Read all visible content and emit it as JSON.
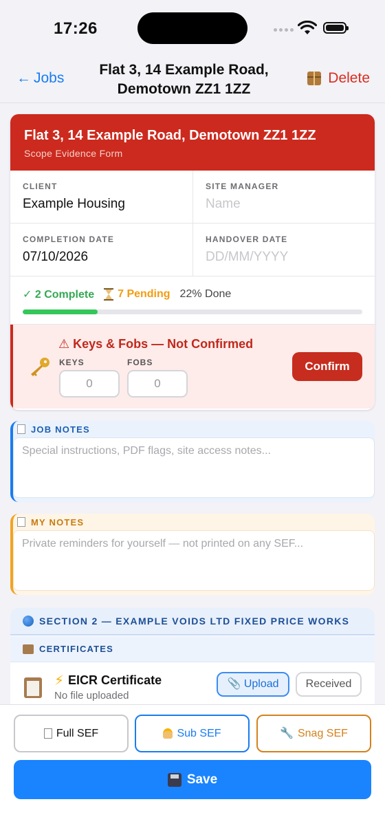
{
  "status_bar": {
    "time": "17:26"
  },
  "nav": {
    "back_label": "Jobs",
    "back_arrow": "←",
    "title": "Flat 3, 14 Example Road, Demotown ZZ1 1ZZ",
    "delete_label": "Delete"
  },
  "job": {
    "address": "Flat 3, 14 Example Road, Demotown ZZ1 1ZZ",
    "form_type": "Scope Evidence Form",
    "client_label": "CLIENT",
    "client_value": "Example Housing",
    "site_manager_label": "SITE MANAGER",
    "site_manager_placeholder": "Name",
    "completion_label": "COMPLETION DATE",
    "completion_value": "07/10/2026",
    "handover_label": "HANDOVER DATE",
    "handover_placeholder": "DD/MM/YYYY"
  },
  "progress": {
    "complete_text": "✓ 2 Complete",
    "pending_text": "7 Pending",
    "done_text": "22% Done",
    "fraction": 0.22,
    "accent": "#34c759"
  },
  "keys": {
    "title": "⚠ Keys & Fobs — Not Confirmed",
    "keys_label": "KEYS",
    "keys_value": "0",
    "fobs_label": "FOBS",
    "fobs_value": "0",
    "confirm_label": "Confirm"
  },
  "job_notes": {
    "heading": "JOB NOTES",
    "placeholder": "Special instructions, PDF flags, site access notes..."
  },
  "my_notes": {
    "heading": "MY NOTES",
    "placeholder": "Private reminders for yourself — not printed on any SEF..."
  },
  "section2": {
    "heading": "SECTION 2 — EXAMPLE VOIDS LTD FIXED PRICE WORKS",
    "sub_heading": "CERTIFICATES",
    "items": [
      {
        "icon": "lightning-icon",
        "name": "EICR Certificate",
        "status": "No file uploaded",
        "upload_label": "Upload",
        "received_label": "Received"
      }
    ]
  },
  "bottom_bar": {
    "full_sef_label": "Full SEF",
    "sub_sef_label": "Sub SEF",
    "snag_sef_label": "Snag SEF",
    "save_label": "Save"
  },
  "colors": {
    "brand_red": "#cc2a1e",
    "primary_blue": "#1a84ff",
    "warning_orange": "#f39c12"
  }
}
